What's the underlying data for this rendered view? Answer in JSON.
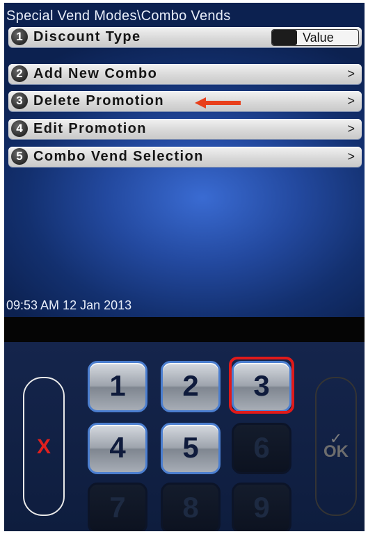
{
  "screen": {
    "title": "Special Vend Modes\\Combo Vends",
    "timestamp": "09:53 AM 12 Jan 2013",
    "menu": [
      {
        "number": "1",
        "label": "Discount Type",
        "control": "toggle",
        "value": "Value"
      },
      {
        "number": "2",
        "label": "Add New Combo",
        "control": "chevron",
        "chevron": ">"
      },
      {
        "number": "3",
        "label": "Delete Promotion",
        "control": "chevron",
        "chevron": ">",
        "annotated": true
      },
      {
        "number": "4",
        "label": "Edit Promotion",
        "control": "chevron",
        "chevron": ">"
      },
      {
        "number": "5",
        "label": "Combo Vend Selection",
        "control": "chevron",
        "chevron": ">"
      }
    ]
  },
  "annotation": {
    "arrow_icon": "left-arrow-icon",
    "arrow_color": "#e8401c",
    "highlight_color": "#e01a1a",
    "highlighted_key": "3"
  },
  "keypad": {
    "cancel_label": "X",
    "ok_check": "✓",
    "ok_label": "OK",
    "keys": [
      {
        "digit": "1",
        "enabled": true
      },
      {
        "digit": "2",
        "enabled": true
      },
      {
        "digit": "3",
        "enabled": true
      },
      {
        "digit": "4",
        "enabled": true
      },
      {
        "digit": "5",
        "enabled": true
      },
      {
        "digit": "6",
        "enabled": false
      },
      {
        "digit": "7",
        "enabled": false
      },
      {
        "digit": "8",
        "enabled": false
      },
      {
        "digit": "9",
        "enabled": false
      }
    ]
  },
  "colors": {
    "screen_blue": "#23499f",
    "row_gray": "#d9d9d9",
    "key_border_blue": "#4b7ecf",
    "cancel_red": "#e0201e"
  }
}
